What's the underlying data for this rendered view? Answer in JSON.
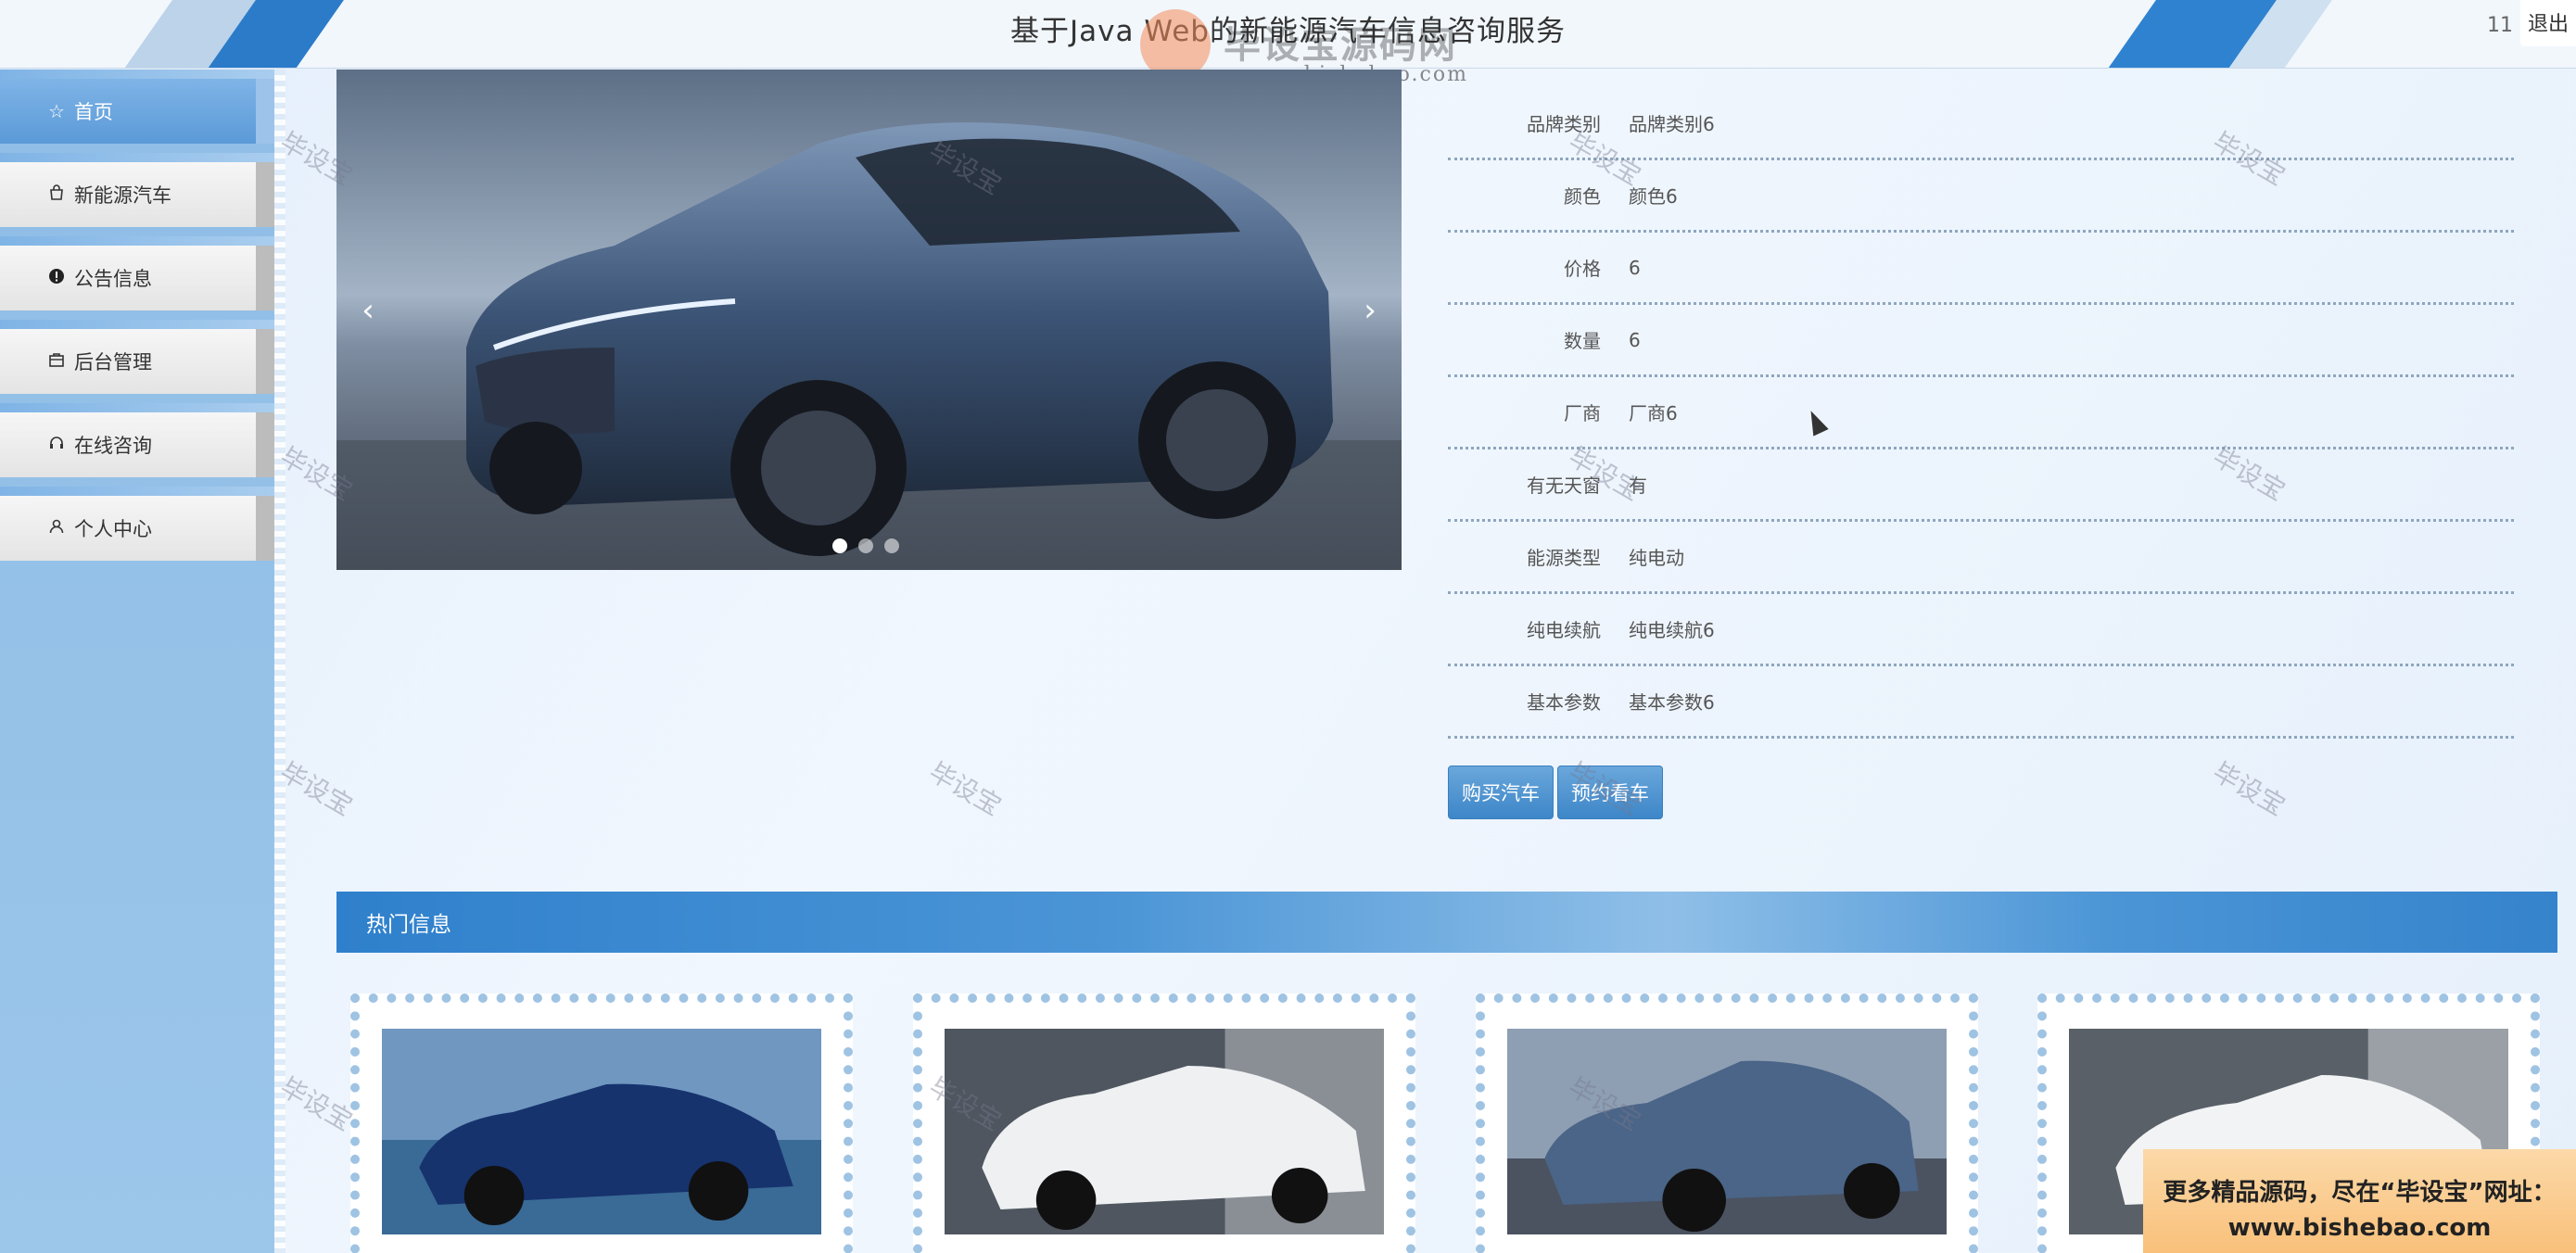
{
  "header": {
    "title": "基于Java Web的新能源汽车信息咨询服务",
    "user_number": "11",
    "logout_label": "退出"
  },
  "overlay_logo": {
    "name": "毕设宝源码网",
    "url": "www.bishebao.com"
  },
  "sidebar": {
    "items": [
      {
        "label": "首页",
        "icon": "star-icon",
        "active": true
      },
      {
        "label": "新能源汽车",
        "icon": "shopping-bag-icon",
        "active": false
      },
      {
        "label": "公告信息",
        "icon": "alert-circle-icon",
        "active": false
      },
      {
        "label": "后台管理",
        "icon": "briefcase-icon",
        "active": false
      },
      {
        "label": "在线咨询",
        "icon": "headset-icon",
        "active": false
      },
      {
        "label": "个人中心",
        "icon": "user-icon",
        "active": false
      }
    ]
  },
  "carousel": {
    "prev_label": "‹",
    "next_label": "›",
    "slides": 3,
    "active_slide": 1
  },
  "details": {
    "rows": [
      {
        "label": "品牌类别",
        "value": "品牌类别6"
      },
      {
        "label": "颜色",
        "value": "颜色6"
      },
      {
        "label": "价格",
        "value": "6"
      },
      {
        "label": "数量",
        "value": "6"
      },
      {
        "label": "厂商",
        "value": "厂商6"
      },
      {
        "label": "有无天窗",
        "value": "有"
      },
      {
        "label": "能源类型",
        "value": "纯电动"
      },
      {
        "label": "纯电续航",
        "value": "纯电续航6"
      },
      {
        "label": "基本参数",
        "value": "基本参数6"
      }
    ],
    "buy_label": "购买汽车",
    "reserve_label": "预约看车"
  },
  "hot": {
    "title": "热门信息",
    "cards": [
      {
        "image": "blue-sedan-photo"
      },
      {
        "image": "white-suv-photo"
      },
      {
        "image": "blue-crossover-photo"
      },
      {
        "image": "white-sedan-photo"
      }
    ]
  },
  "watermark": {
    "text": "毕设宝"
  },
  "promo": {
    "line1": "更多精品源码，尽在“毕设宝”网址：",
    "line2": "www.bishebao.com"
  },
  "colors": {
    "accent": "#2f80cc",
    "sidebar": "#9cc6ea",
    "button": "#4a8fcc"
  }
}
